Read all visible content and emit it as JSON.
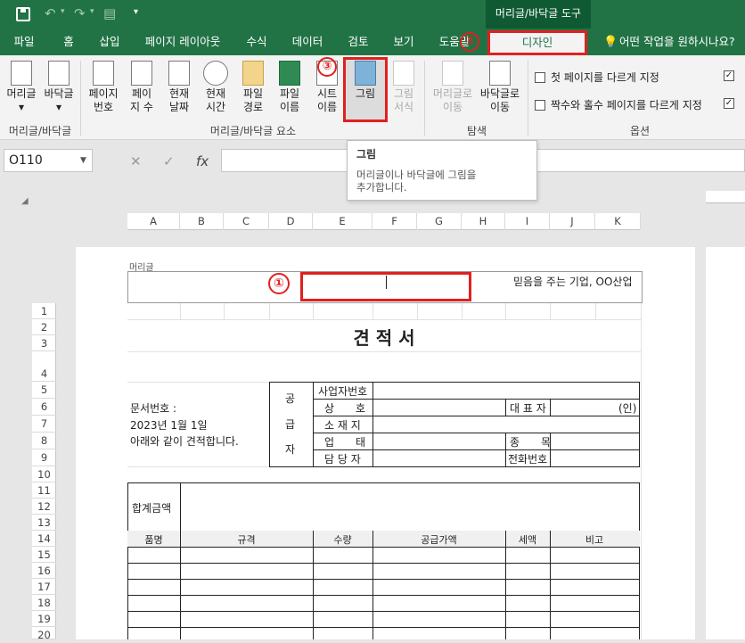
{
  "titlebar": {
    "context_tab_header": "머리글/바닥글 도구",
    "save_icon": "save-icon",
    "undo_icon": "undo-icon",
    "redo_icon": "redo-icon"
  },
  "tabs": [
    "파일",
    "홈",
    "삽입",
    "페이지 레이아웃",
    "수식",
    "데이터",
    "검토",
    "보기",
    "도움말",
    "디자인"
  ],
  "search_text": "어떤 작업을 원하시나요?",
  "ribbon": {
    "groups": [
      {
        "label": "머리글/바닥글",
        "buttons": [
          {
            "label": "머리글",
            "sub": "▾"
          },
          {
            "label": "바닥글",
            "sub": "▾"
          }
        ]
      },
      {
        "label": "머리글/바닥글 요소",
        "buttons": [
          {
            "l1": "페이지",
            "l2": "번호"
          },
          {
            "l1": "페이",
            "l2": "지 수"
          },
          {
            "l1": "현재",
            "l2": "날짜"
          },
          {
            "l1": "현재",
            "l2": "시간"
          },
          {
            "l1": "파일",
            "l2": "경로"
          },
          {
            "l1": "파일",
            "l2": "이름"
          },
          {
            "l1": "시트",
            "l2": "이름"
          },
          {
            "l1": "그림",
            "l2": ""
          },
          {
            "l1": "그림",
            "l2": "서식"
          }
        ]
      },
      {
        "label": "탐색",
        "buttons": [
          {
            "l1": "머리글로",
            "l2": "이동"
          },
          {
            "l1": "바닥글로",
            "l2": "이동"
          }
        ]
      },
      {
        "label": "옵션",
        "checks": [
          "첫 페이지를 다르게 지정",
          "짝수와 홀수 페이지를 다르게 지정"
        ]
      }
    ]
  },
  "formula_bar": {
    "name_box": "O110",
    "cancel": "✕",
    "enter": "✓",
    "fx": "fx"
  },
  "tooltip": {
    "title": "그림",
    "desc1": "머리글이나 바닥글에 그림을",
    "desc2": "추가합니다."
  },
  "columns": [
    "A",
    "B",
    "C",
    "D",
    "E",
    "F",
    "G",
    "H",
    "I",
    "J",
    "K"
  ],
  "rows": [
    "1",
    "2",
    "3",
    "4",
    "5",
    "6",
    "7",
    "8",
    "9",
    "10",
    "11",
    "12",
    "13",
    "14",
    "15",
    "16",
    "17",
    "18",
    "19",
    "20"
  ],
  "header_area": {
    "label": "머리글",
    "right_text": "믿음을 주는 기업, OO산업"
  },
  "form": {
    "title": "견 적 서",
    "doc_no": "문서번호 :",
    "date": "2023년 1월 1일",
    "note": "아래와 같이 견적합니다.",
    "supplier_chars": [
      "공",
      "급",
      "자"
    ],
    "supplier_fields": [
      "사업자번호",
      "상　　호",
      "소 재 지",
      "업　　태",
      "담 당 자"
    ],
    "rep": "대 표 자",
    "seal": "(인)",
    "item": "종　　목",
    "phone": "전화번호",
    "total": "합계금액",
    "table_headers": [
      "품명",
      "규격",
      "수량",
      "공급가액",
      "세액",
      "비고"
    ]
  },
  "markers": [
    "①",
    "②",
    "③"
  ]
}
